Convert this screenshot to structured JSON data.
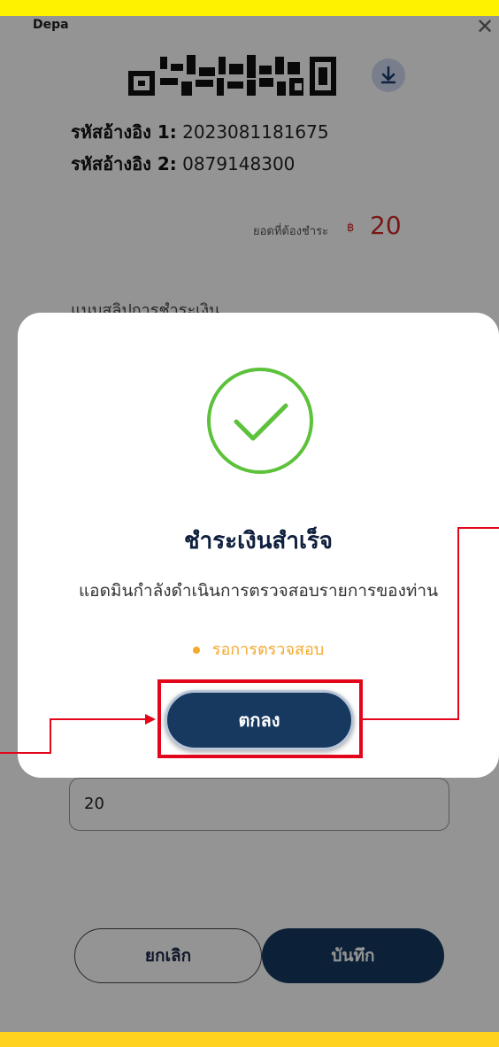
{
  "app": {
    "title": "Depa"
  },
  "payment": {
    "ref1_label": "รหัสอ้างอิง 1:",
    "ref1_value": "2023081181675",
    "ref2_label": "รหัสอ้างอิง 2:",
    "ref2_value": "0879148300",
    "due_label": "ยอดที่ต้องชำระ",
    "currency_symbol": "฿",
    "due_amount": "20",
    "attach_label": "แนบสลิปการชำระเงิน",
    "amount_value": "20"
  },
  "buttons": {
    "cancel": "ยกเลิก",
    "save": "บันทึก"
  },
  "modal": {
    "title": "ชำระเงินสำเร็จ",
    "description": "แอดมินกำลังดำเนินการตรวจสอบรายการของท่าน",
    "status": "รอการตรวจสอบ",
    "ok_button": "ตกลง"
  },
  "colors": {
    "accent": "#16395f",
    "success": "#5cc13b",
    "warning": "#f4a92b",
    "price": "#d12a2a",
    "annotation": "#e3061b"
  },
  "icons": [
    "close-icon",
    "download-icon",
    "check-circle-icon",
    "qr-code-image"
  ]
}
